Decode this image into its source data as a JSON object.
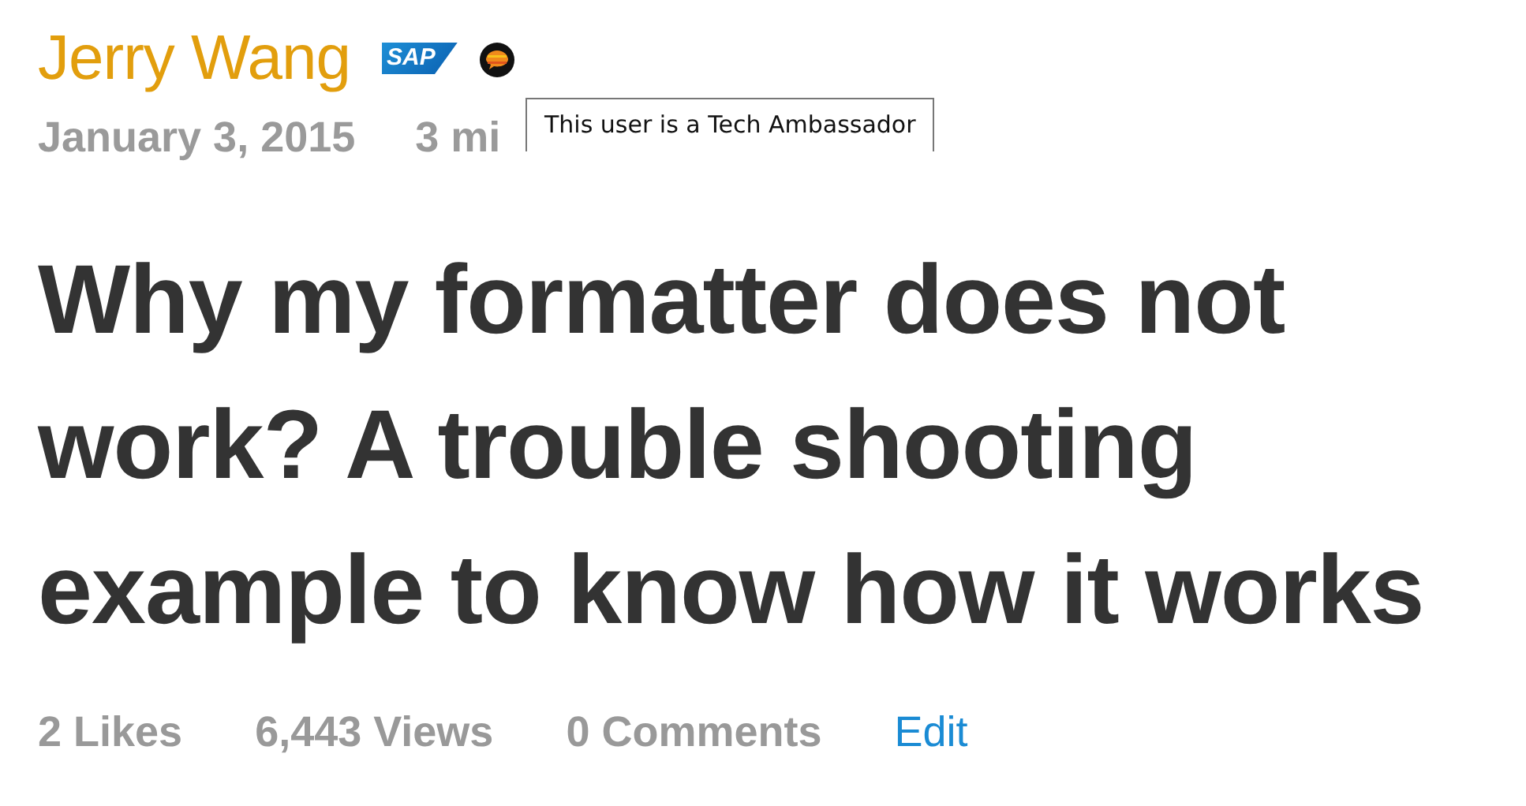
{
  "author": {
    "name": "Jerry Wang",
    "company_badge": "SAP"
  },
  "tooltip": "This user is a Tech Ambassador",
  "meta": {
    "date": "January 3, 2015",
    "read_time": "3 mi"
  },
  "title": "Why my formatter does not work? A trouble shooting example to know how it works",
  "stats": [
    {
      "kind": "stat",
      "text": "2 Likes"
    },
    {
      "kind": "stat",
      "text": "6,443 Views"
    },
    {
      "kind": "stat",
      "text": "0 Comments"
    },
    {
      "kind": "link",
      "text": "Edit"
    }
  ]
}
